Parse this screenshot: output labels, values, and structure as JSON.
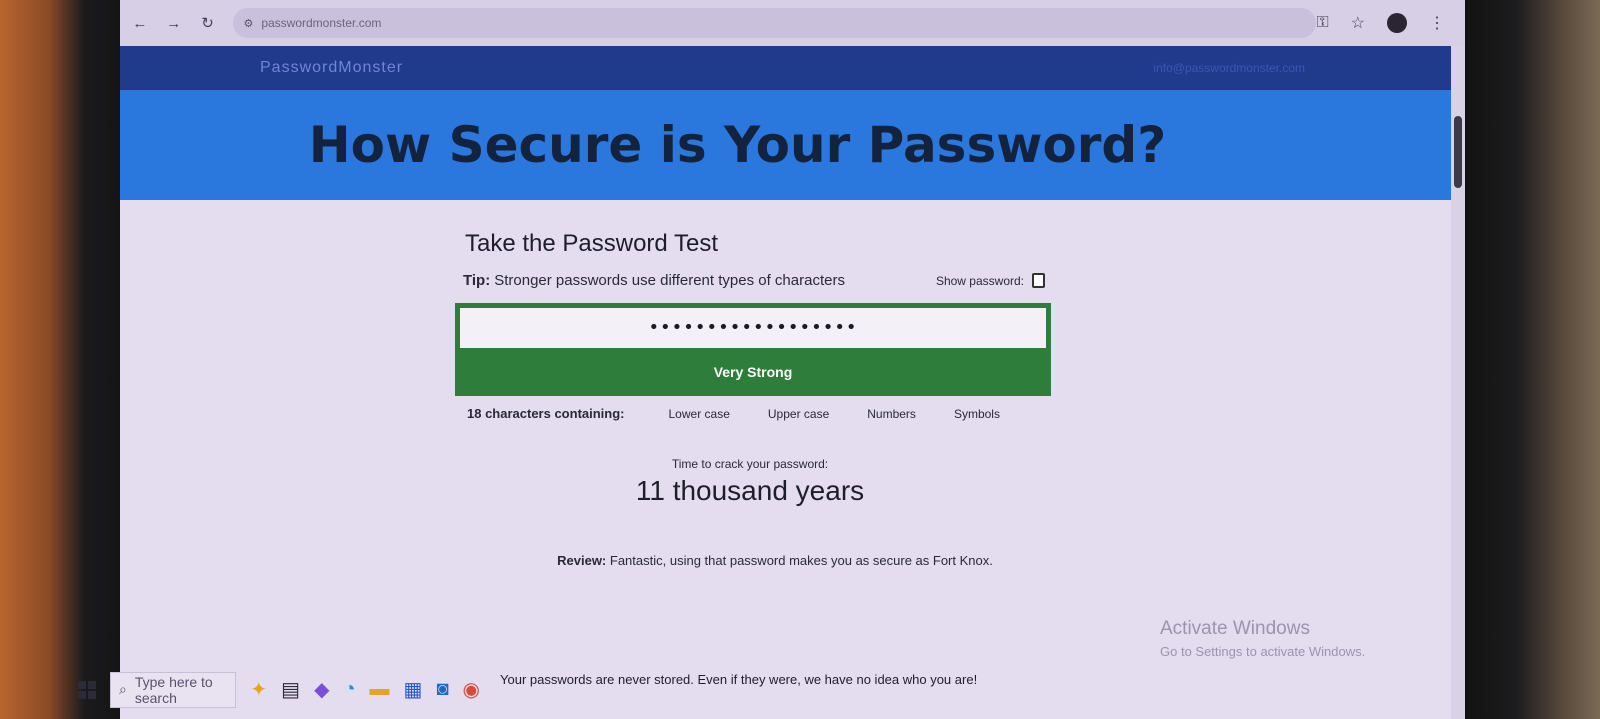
{
  "browser": {
    "url": "passwordmonster.com",
    "back_icon": "back-arrow-icon",
    "forward_icon": "forward-arrow-icon",
    "reload_icon": "reload-icon"
  },
  "site": {
    "logo": "PasswordMonster",
    "email": "info@passwordmonster.com",
    "hero_title": "How Secure is Your Password?"
  },
  "test": {
    "title": "Take the Password Test",
    "tip_label": "Tip:",
    "tip_text": "Stronger passwords use different types of characters",
    "show_password_label": "Show password:",
    "password_value": "••••••••••••••••••",
    "strength_label": "Very Strong",
    "strength_color": "#2e7d3a",
    "char_count_label": "18 characters containing:",
    "char_types": [
      "Lower case",
      "Upper case",
      "Numbers",
      "Symbols"
    ],
    "crack_label": "Time to crack your password:",
    "crack_value": "11 thousand years",
    "review_label": "Review:",
    "review_text": "Fantastic, using that password makes you as secure as Fort Knox."
  },
  "footer_note": "Your passwords are never stored. Even if they were, we have no idea who you are!",
  "windows": {
    "activate_title": "Activate Windows",
    "activate_subtitle": "Go to Settings to activate Windows.",
    "search_placeholder": "Type here to search"
  }
}
